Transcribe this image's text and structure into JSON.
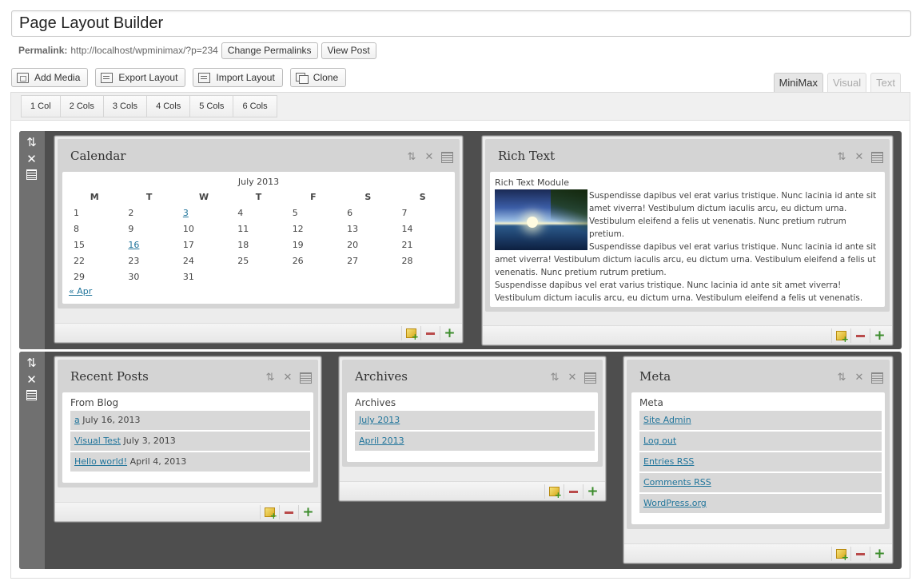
{
  "title_value": "Page Layout Builder",
  "permalink": {
    "label": "Permalink:",
    "url": "http://localhost/wpminimax/?p=234",
    "change_button": "Change Permalinks",
    "view_button": "View Post"
  },
  "media_buttons": {
    "add_media": "Add Media",
    "export_layout": "Export Layout",
    "import_layout": "Import Layout",
    "clone": "Clone"
  },
  "editor_tabs": {
    "minimax": "MiniMax",
    "visual": "Visual",
    "text": "Text"
  },
  "column_buttons": [
    "1 Col",
    "2 Cols",
    "3 Cols",
    "4 Cols",
    "5 Cols",
    "6 Cols"
  ],
  "icons": {
    "row_handle": [
      "sort-icon",
      "close-icon",
      "settings-icon"
    ],
    "module_controls": [
      "sort-icon",
      "close-icon",
      "settings-icon"
    ],
    "module_footer": [
      "add-module-icon",
      "remove-icon",
      "add-icon"
    ]
  },
  "calendar": {
    "title": "Calendar",
    "caption": "July 2013",
    "weekdays": [
      "M",
      "T",
      "W",
      "T",
      "F",
      "S",
      "S"
    ],
    "weeks": [
      [
        "1",
        "2",
        "3",
        "4",
        "5",
        "6",
        "7"
      ],
      [
        "8",
        "9",
        "10",
        "11",
        "12",
        "13",
        "14"
      ],
      [
        "15",
        "16",
        "17",
        "18",
        "19",
        "20",
        "21"
      ],
      [
        "22",
        "23",
        "24",
        "25",
        "26",
        "27",
        "28"
      ],
      [
        "29",
        "30",
        "31",
        "",
        "",
        "",
        ""
      ]
    ],
    "linked_days": [
      "3",
      "16"
    ],
    "prev_link": "« Apr"
  },
  "rich_text": {
    "title": "Rich Text",
    "module_title": "Rich Text Module",
    "paragraph_1": "Suspendisse dapibus vel erat varius tristique. Nunc lacinia id ante sit amet viverra! Vestibulum dictum iaculis arcu, eu dictum urna. Vestibulum eleifend a felis ut venenatis. Nunc pretium rutrum pretium.",
    "paragraph_2": "Suspendisse dapibus vel erat varius tristique. Nunc lacinia id ante sit amet viverra! Vestibulum dictum iaculis arcu, eu dictum urna. Vestibulum eleifend a felis ut venenatis. Nunc pretium rutrum pretium.",
    "paragraph_3": "Suspendisse dapibus vel erat varius tristique. Nunc lacinia id ante sit amet viverra! Vestibulum dictum iaculis arcu, eu dictum urna. Vestibulum eleifend a felis ut venenatis. Nunc pretium rutrum pretium."
  },
  "recent_posts": {
    "title": "Recent Posts",
    "widget_title": "From Blog",
    "items": [
      {
        "link": "a",
        "date": "July 16, 2013"
      },
      {
        "link": "Visual Test",
        "date": "July 3, 2013"
      },
      {
        "link": "Hello world!",
        "date": "April 4, 2013"
      }
    ]
  },
  "archives": {
    "title": "Archives",
    "widget_title": "Archives",
    "items": [
      "July 2013",
      "April 2013"
    ]
  },
  "meta": {
    "title": "Meta",
    "widget_title": "Meta",
    "items": [
      "Site Admin",
      "Log out",
      "Entries RSS",
      "Comments RSS",
      "WordPress.org"
    ]
  }
}
